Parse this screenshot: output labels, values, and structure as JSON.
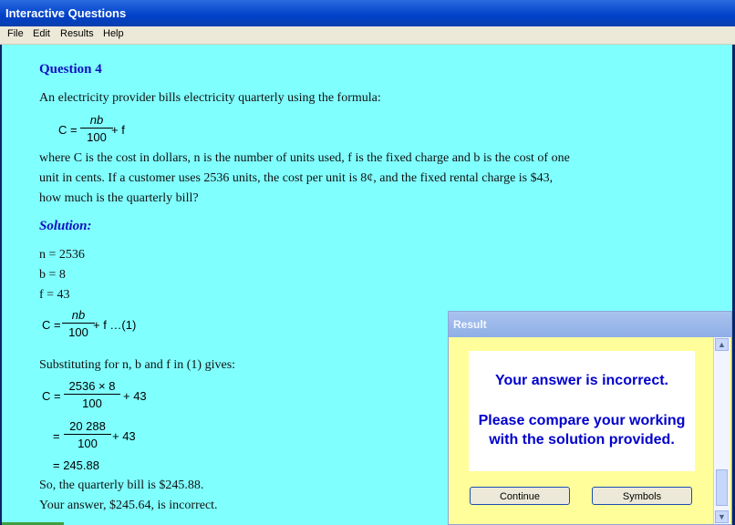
{
  "window": {
    "title": "Interactive Questions"
  },
  "menu": {
    "file": "File",
    "edit": "Edit",
    "results": "Results",
    "help": "Help"
  },
  "question": {
    "heading": "Question 4",
    "intro": "An electricity provider bills electricity quarterly using the formula:",
    "formula": {
      "lhs": "C =",
      "num": "nb",
      "den": "100",
      "rest": "+ f"
    },
    "body_line1": "where C is the cost in dollars, n is the number of units used, f is the fixed charge and b is the cost of one",
    "body_line2": "unit in cents.  If a customer uses 2536 units, the cost per unit is 8¢, and the fixed rental charge is $43,",
    "body_line3": "how much is the quarterly bill?"
  },
  "solution": {
    "heading": "Solution:",
    "n": "n = 2536",
    "b": "b = 8",
    "f": "f = 43",
    "eq1": {
      "lhs": "C =",
      "num": "nb",
      "den": "100",
      "rest": "+ f  …(1)"
    },
    "subst": "Substituting for n, b and f in (1) gives:",
    "step1": {
      "lhs": "C =",
      "num": "2536 × 8",
      "den": "100",
      "rest": "+ 43"
    },
    "step2": {
      "lhs": "=",
      "num": "20 288",
      "den": "100",
      "rest": "+ 43"
    },
    "step3": "= 245.88",
    "answer_line": "So, the quarterly bill is $245.88.",
    "user_line": "Your answer, $245.64, is incorrect."
  },
  "dialog": {
    "title": "Result",
    "message1": "Your answer is incorrect.",
    "message2": "Please compare your working with the solution provided.",
    "continue_label": "Continue",
    "symbols_label": "Symbols"
  },
  "colors": {
    "content_bg": "#80ffff",
    "heading": "#1010c0",
    "dialog_bg": "#fffe9a",
    "message": "#0000cc"
  }
}
